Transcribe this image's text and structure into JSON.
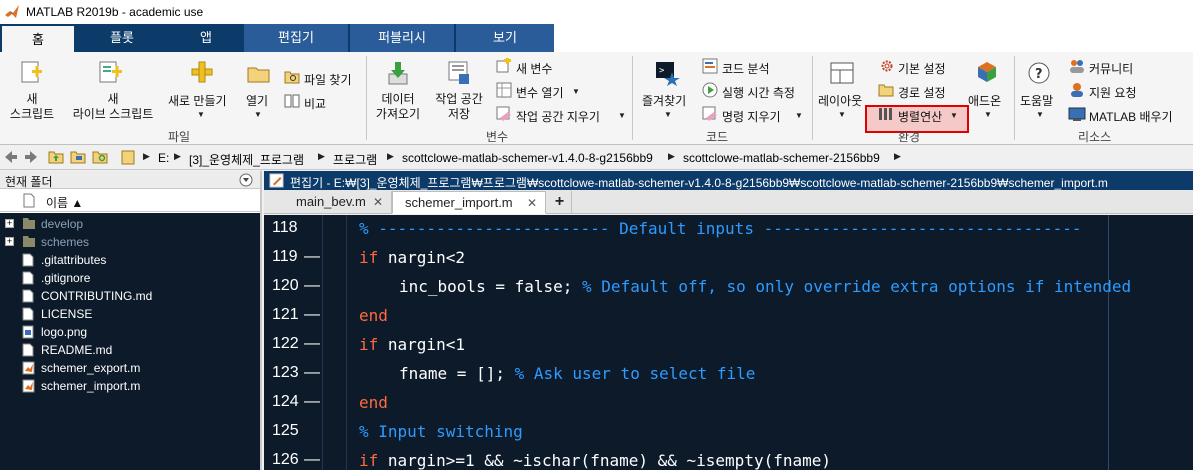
{
  "window": {
    "title": "MATLAB R2019b - academic use"
  },
  "tabs": [
    {
      "label": "홈"
    },
    {
      "label": "플롯"
    },
    {
      "label": "앱"
    },
    {
      "label": "편집기"
    },
    {
      "label": "퍼블리시"
    },
    {
      "label": "보기"
    }
  ],
  "ribbon": {
    "file": {
      "section_label": "파일",
      "new_script": "새\n스크립트",
      "new_live_script": "새\n라이브 스크립트",
      "new_make": "새로 만들기",
      "open": "열기",
      "find_files": "파일 찾기",
      "compare": "비교"
    },
    "variable": {
      "section_label": "변수",
      "import_data": "데이터\n가져오기",
      "save_workspace": "작업 공간\n저장",
      "new_variable": "새 변수",
      "open_variable": "변수 열기",
      "clear_workspace": "작업 공간 지우기"
    },
    "code": {
      "section_label": "코드",
      "favorites": "즐겨찾기",
      "analyze_code": "코드 분석",
      "run_and_time": "실행 시간 측정",
      "clear_commands": "명령 지우기"
    },
    "environment": {
      "section_label": "환경",
      "layout": "레이아웃",
      "preferences": "기본 설정",
      "set_path": "경로 설정",
      "parallel": "병렬연산",
      "addons": "애드온"
    },
    "resources": {
      "section_label": "리소스",
      "help": "도움말",
      "community": "커뮤니티",
      "request_support": "지원 요청",
      "learn_matlab": "MATLAB 배우기"
    }
  },
  "address": {
    "crumbs": [
      "E:",
      "[3]_운영체제_프로그램",
      "프로그램",
      "scottclowe-matlab-schemer-v1.4.0-8-g2156bb9",
      "scottclowe-matlab-schemer-2156bb9"
    ]
  },
  "folder_panel": {
    "title": "현재 폴더",
    "name_column": "이름 ▲",
    "items": [
      {
        "name": "develop",
        "type": "folder"
      },
      {
        "name": "schemes",
        "type": "folder"
      },
      {
        "name": ".gitattributes",
        "type": "file"
      },
      {
        "name": ".gitignore",
        "type": "file"
      },
      {
        "name": "CONTRIBUTING.md",
        "type": "file"
      },
      {
        "name": "LICENSE",
        "type": "file"
      },
      {
        "name": "logo.png",
        "type": "image"
      },
      {
        "name": "README.md",
        "type": "file"
      },
      {
        "name": "schemer_export.m",
        "type": "mfile"
      },
      {
        "name": "schemer_import.m",
        "type": "mfile"
      }
    ]
  },
  "editor": {
    "title": "편집기 - E:₩[3]_운영체제_프로그램₩프로그램₩scottclowe-matlab-schemer-v1.4.0-8-g2156bb9₩scottclowe-matlab-schemer-2156bb9₩schemer_import.m",
    "tabs": [
      {
        "label": "main_bev.m"
      },
      {
        "label": "schemer_import.m"
      }
    ],
    "lines": [
      {
        "num": "118",
        "dash": "",
        "indent": 0,
        "parts": [
          {
            "t": "% ------------------------ Default inputs ---------------------------------",
            "c": "cm"
          }
        ]
      },
      {
        "num": "119",
        "dash": "—",
        "indent": 0,
        "parts": [
          {
            "t": "if",
            "c": "kw"
          },
          {
            "t": " nargin<2",
            "c": "plain"
          }
        ]
      },
      {
        "num": "120",
        "dash": "—",
        "indent": 1,
        "parts": [
          {
            "t": "inc_bools = false; ",
            "c": "plain"
          },
          {
            "t": "% Default off, so only override extra options if intended",
            "c": "cm"
          }
        ]
      },
      {
        "num": "121",
        "dash": "—",
        "indent": 0,
        "parts": [
          {
            "t": "end",
            "c": "kw"
          }
        ]
      },
      {
        "num": "122",
        "dash": "—",
        "indent": 0,
        "parts": [
          {
            "t": "if",
            "c": "kw"
          },
          {
            "t": " nargin<1",
            "c": "plain"
          }
        ]
      },
      {
        "num": "123",
        "dash": "—",
        "indent": 1,
        "parts": [
          {
            "t": "fname = []; ",
            "c": "plain"
          },
          {
            "t": "% Ask user to select file",
            "c": "cm"
          }
        ]
      },
      {
        "num": "124",
        "dash": "—",
        "indent": 0,
        "parts": [
          {
            "t": "end",
            "c": "kw"
          }
        ]
      },
      {
        "num": "125",
        "dash": "",
        "indent": 0,
        "parts": [
          {
            "t": "% Input switching",
            "c": "cm"
          }
        ]
      },
      {
        "num": "126",
        "dash": "—",
        "indent": 0,
        "parts": [
          {
            "t": "if",
            "c": "kw"
          },
          {
            "t": " nargin>=1 && ~ischar(fname) && ~isempty(fname)",
            "c": "plain"
          }
        ]
      }
    ]
  },
  "colors": {
    "tab_band": "#0c3a69",
    "editor_bg": "#0c1a2a",
    "keyword": "#ff6a3d",
    "comment": "#2e9bff",
    "highlight_border": "#e00000"
  }
}
